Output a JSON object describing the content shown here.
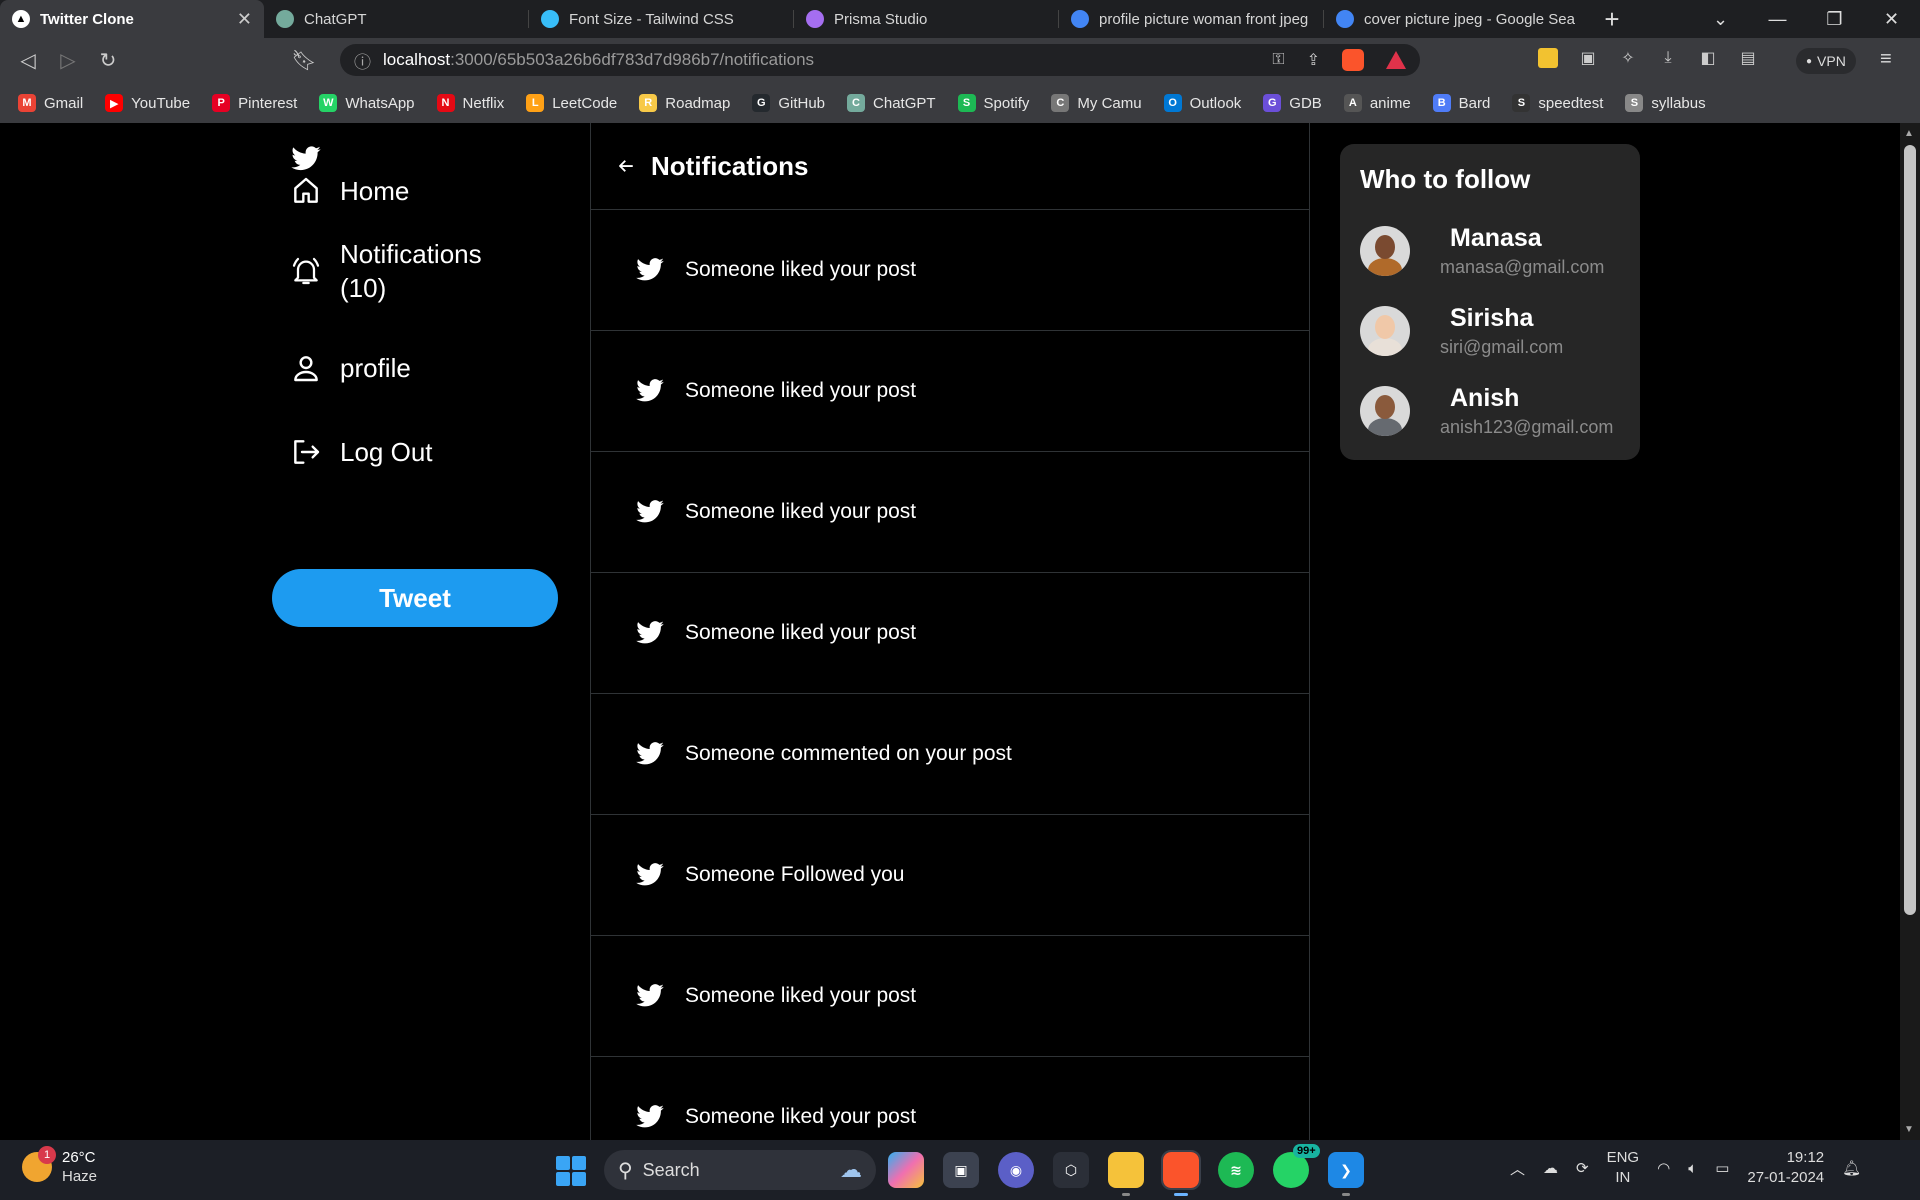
{
  "browser": {
    "tabs": [
      {
        "title": "Twitter Clone",
        "icon": "twitter-clone-favicon",
        "color": "#000000"
      },
      {
        "title": "ChatGPT",
        "icon": "chatgpt-favicon",
        "color": "#74aa9c"
      },
      {
        "title": "Font Size - Tailwind CSS",
        "icon": "tailwind-favicon",
        "color": "#38bdf8"
      },
      {
        "title": "Prisma Studio",
        "icon": "prisma-favicon",
        "color": "#a56ef0"
      },
      {
        "title": "profile picture woman front jpeg",
        "icon": "google-favicon",
        "color": "#4285f4"
      },
      {
        "title": "cover picture jpeg - Google Sear",
        "icon": "google-favicon",
        "color": "#4285f4"
      }
    ],
    "url_host": "localhost",
    "url_path": ":3000/65b503a26b6df783d7d986b7/notifications",
    "vpn_label": "VPN",
    "bookmarks": [
      {
        "label": "Gmail",
        "color": "#ea4335",
        "glyph": "M"
      },
      {
        "label": "YouTube",
        "color": "#ff0000",
        "glyph": "▶"
      },
      {
        "label": "Pinterest",
        "color": "#e60023",
        "glyph": "P"
      },
      {
        "label": "WhatsApp",
        "color": "#25d366",
        "glyph": "W"
      },
      {
        "label": "Netflix",
        "color": "#e50914",
        "glyph": "N"
      },
      {
        "label": "LeetCode",
        "color": "#ffa116",
        "glyph": "L"
      },
      {
        "label": "Roadmap",
        "color": "#f7c948",
        "glyph": "R"
      },
      {
        "label": "GitHub",
        "color": "#24292e",
        "glyph": "G"
      },
      {
        "label": "ChatGPT",
        "color": "#74aa9c",
        "glyph": "C"
      },
      {
        "label": "Spotify",
        "color": "#1db954",
        "glyph": "S"
      },
      {
        "label": "My Camu",
        "color": "#777777",
        "glyph": "C"
      },
      {
        "label": "Outlook",
        "color": "#0078d4",
        "glyph": "O"
      },
      {
        "label": "GDB",
        "color": "#6b4fd8",
        "glyph": "G"
      },
      {
        "label": "anime",
        "color": "#555555",
        "glyph": "A"
      },
      {
        "label": "Bard",
        "color": "#4f7cf7",
        "glyph": "B"
      },
      {
        "label": "speedtest",
        "color": "#333333",
        "glyph": "S"
      },
      {
        "label": "syllabus",
        "color": "#888888",
        "glyph": "S"
      }
    ]
  },
  "sidebar": {
    "nav": [
      {
        "label": "Home",
        "icon": "home-icon"
      },
      {
        "label": "Notifications (10)",
        "icon": "bell-icon"
      },
      {
        "label": "profile",
        "icon": "user-icon"
      },
      {
        "label": "Log Out",
        "icon": "logout-icon"
      }
    ],
    "tweet_label": "Tweet"
  },
  "feed": {
    "title": "Notifications",
    "notifications": [
      "Someone liked your post",
      "Someone liked your post",
      "Someone liked your post",
      "Someone liked your post",
      "Someone commented on your post",
      "Someone Followed you",
      "Someone liked your post",
      "Someone liked your post"
    ]
  },
  "follow": {
    "title": "Who to follow",
    "users": [
      {
        "name": "Manasa",
        "email": "manasa@gmail.com",
        "skin": "#7a4a30",
        "shirt": "#b06a2a"
      },
      {
        "name": "Sirisha",
        "email": "siri@gmail.com",
        "skin": "#f0c8a8",
        "shirt": "#e8e0d8"
      },
      {
        "name": "Anish",
        "email": "anish123@gmail.com",
        "skin": "#8a5a3c",
        "shirt": "#666a70"
      }
    ]
  },
  "taskbar": {
    "weather_badge": "1",
    "temperature": "26°C",
    "condition": "Haze",
    "search_label": "Search",
    "whatsapp_count": "99+",
    "lang_top": "ENG",
    "lang_bottom": "IN",
    "time": "19:12",
    "date": "27-01-2024"
  },
  "colors": {
    "accent": "#1d9bf0",
    "card": "#262626",
    "border": "#2f3336"
  }
}
